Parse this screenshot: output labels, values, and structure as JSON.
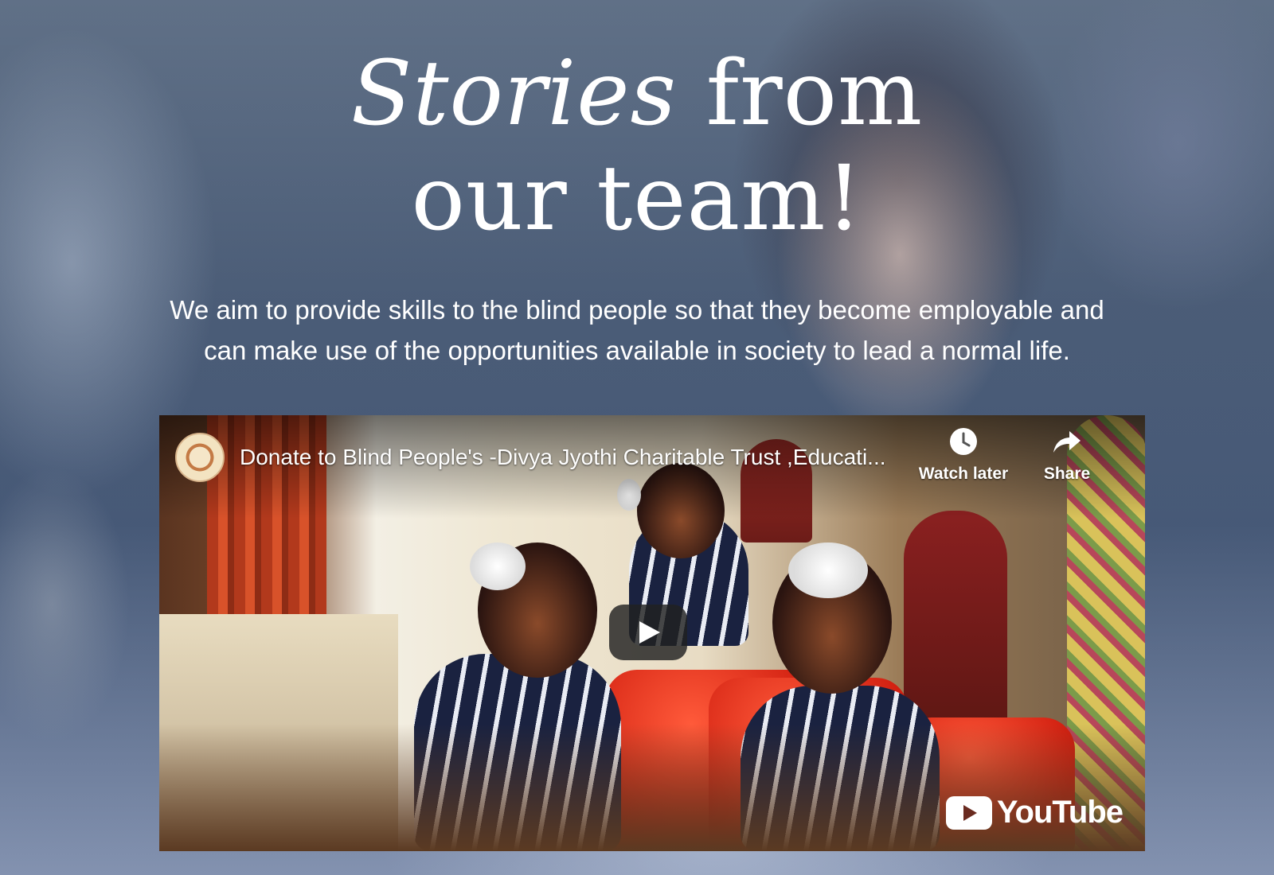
{
  "hero": {
    "title_italic": "Stories",
    "title_rest": " from",
    "title_line2": "our team!",
    "description": "We aim to provide skills to the blind people so that they become employable and can make use of the opportunities available in society to lead a normal life."
  },
  "video": {
    "title": "Donate to Blind People's -Divya Jyothi Charitable Trust ,Educati...",
    "watch_later_label": "Watch later",
    "share_label": "Share",
    "brand_label": "YouTube",
    "icons": {
      "watch_later": "clock-icon",
      "share": "share-arrow-icon",
      "play": "play-icon",
      "channel": "channel-logo-icon"
    }
  },
  "colors": {
    "text": "#ffffff",
    "play_bg": "#212121"
  }
}
